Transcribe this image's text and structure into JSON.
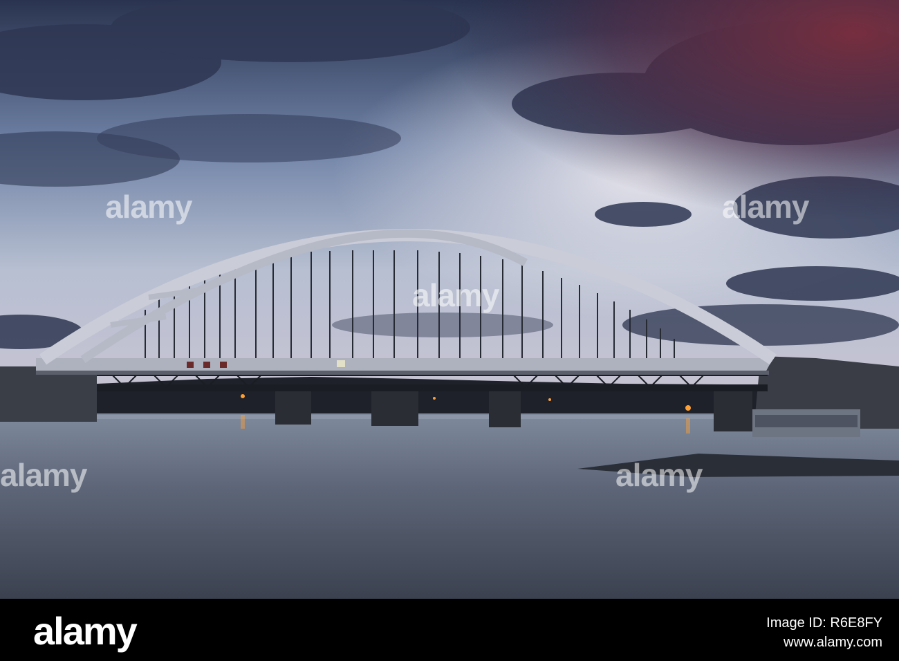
{
  "watermark": {
    "text": "alamy"
  },
  "footer": {
    "logo": "alamy",
    "image_id": "Image ID: R6E8FY",
    "site": "www.alamy.com"
  },
  "palette": {
    "sky_top": "#27304a",
    "sky_mid": "#8a9bbb",
    "sky_glow": "#d9dbe6",
    "cloud_dark": "#2e3550",
    "cloud_red": "#6a2a3a",
    "water_top": "#6f7a8c",
    "water_bottom": "#3a404d",
    "bridge_arch": "#cfd2dc",
    "bridge_dark": "#1a1d24",
    "lamp": "#ff9a2a"
  }
}
